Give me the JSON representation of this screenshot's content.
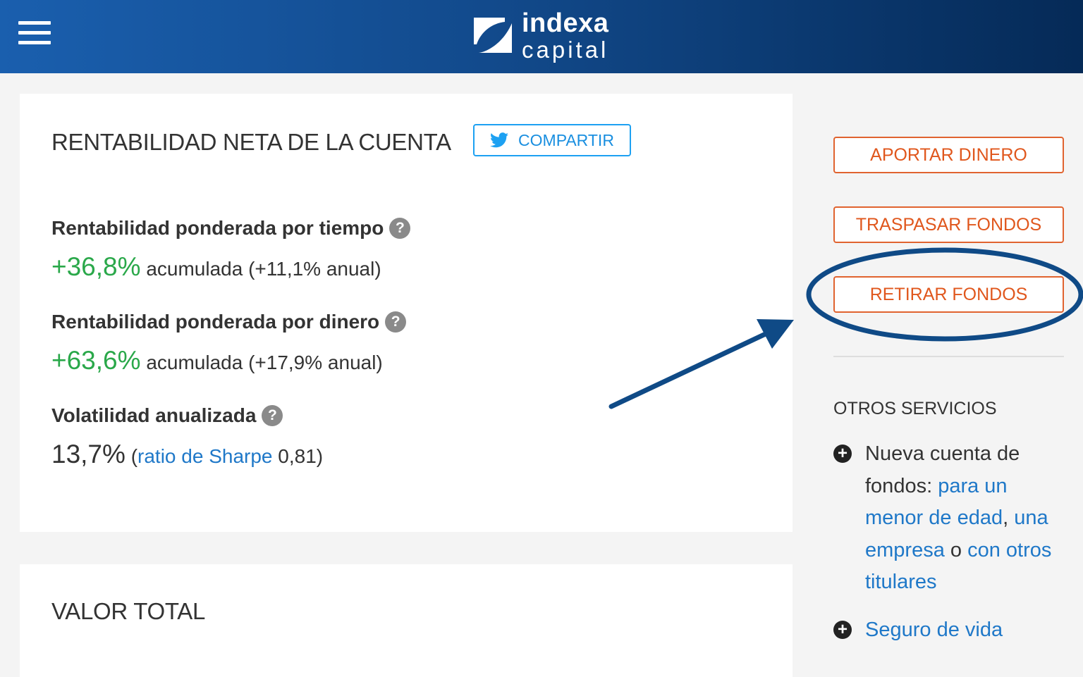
{
  "brand": {
    "line1": "indexa",
    "line2": "capital"
  },
  "account_returns": {
    "title": "RENTABILIDAD NETA DE LA CUENTA",
    "share_label": "COMPARTIR",
    "time_weighted": {
      "label": "Rentabilidad ponderada por tiempo",
      "help": "?",
      "value": "+36,8%",
      "detail": "acumulada (+11,1% anual)"
    },
    "money_weighted": {
      "label": "Rentabilidad ponderada por dinero",
      "help": "?",
      "value": "+63,6%",
      "detail": "acumulada (+17,9% anual)"
    },
    "volatility": {
      "label": "Volatilidad anualizada",
      "help": "?",
      "value": "13,7%",
      "paren_open": "(",
      "sharpe_link": "ratio de Sharpe",
      "sharpe_value": "0,81)"
    }
  },
  "total_value": {
    "title": "VALOR TOTAL"
  },
  "sidebar": {
    "buttons": {
      "deposit": "APORTAR DINERO",
      "transfer": "TRASPASAR FONDOS",
      "withdraw": "RETIRAR FONDOS"
    },
    "other_services": {
      "title": "OTROS SERVICIOS",
      "new_account": {
        "prefix": "Nueva cuenta de fondos:",
        "minor_link": "para un menor de edad",
        "sep1": ",",
        "company_link": "una empresa",
        "sep2": "o",
        "joint_link": "con otros titulares"
      },
      "life_insurance": "Seguro de vida"
    }
  },
  "colors": {
    "header_start": "#1a5fae",
    "header_end": "#052a57",
    "positive": "#2aa84a",
    "link": "#1f78c8",
    "action": "#e0571d",
    "twitter": "#1da1f2",
    "annotation": "#0f4a86"
  },
  "icons": [
    "menu-icon",
    "logo-icon",
    "twitter-icon",
    "help-icon",
    "plus-circle-icon"
  ]
}
